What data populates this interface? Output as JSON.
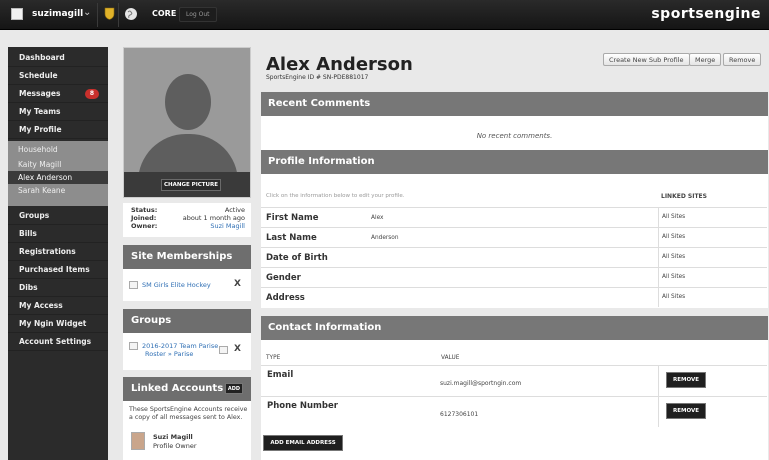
{
  "topbar": {
    "username": "suzimagill",
    "core_label": "CORE",
    "logout_label": "Log Out",
    "brand": "sportsengine"
  },
  "nav": {
    "items": [
      {
        "label": "Dashboard"
      },
      {
        "label": "Schedule"
      },
      {
        "label": "Messages",
        "badge": "8"
      },
      {
        "label": "My Teams"
      },
      {
        "label": "My Profile"
      }
    ],
    "household": {
      "title": "Household",
      "members": [
        "Kaity Magill",
        "Alex Anderson",
        "Sarah Keane"
      ],
      "active_member": "Alex Anderson"
    },
    "items2": [
      {
        "label": "Groups"
      },
      {
        "label": "Bills"
      },
      {
        "label": "Registrations"
      },
      {
        "label": "Purchased Items"
      },
      {
        "label": "Dibs"
      },
      {
        "label": "My Access"
      },
      {
        "label": "My Ngin Widget"
      },
      {
        "label": "Account Settings"
      }
    ]
  },
  "profile": {
    "change_picture_label": "CHANGE PICTURE",
    "status_label": "Status:",
    "status_value": "Active",
    "joined_label": "Joined:",
    "joined_value": "about 1 month ago",
    "owner_label": "Owner:",
    "owner_value": "Suzi Magill"
  },
  "site_memberships": {
    "title": "Site Memberships",
    "items": [
      {
        "name": "SM Girls Elite Hockey",
        "remove": "X"
      }
    ]
  },
  "groups": {
    "title": "Groups",
    "items": [
      {
        "line1": "2016-2017 Team Parise",
        "line2": "Roster » Parise",
        "remove": "X"
      }
    ]
  },
  "linked_accounts": {
    "title": "Linked Accounts",
    "add_label": "ADD",
    "description": "These SportsEngine Accounts receive a copy of all messages sent to Alex.",
    "accounts": [
      {
        "name": "Suzi Magill",
        "role": "Profile Owner"
      }
    ]
  },
  "header": {
    "name": "Alex Anderson",
    "se_id": "SportsEngine ID #  SN-PDE881017",
    "buttons": {
      "create_sub": "Create New Sub Profile",
      "merge": "Merge",
      "remove": "Remove"
    }
  },
  "recent_comments": {
    "title": "Recent Comments",
    "empty_text": "No recent comments."
  },
  "profile_info": {
    "title": "Profile Information",
    "hint": "Click on the information below to edit your profile.",
    "linked_sites_header": "LINKED SITES",
    "rows": [
      {
        "label": "First Name",
        "value": "Alex",
        "sites": "All Sites"
      },
      {
        "label": "Last Name",
        "value": "Anderson",
        "sites": "All Sites"
      },
      {
        "label": "Date of Birth",
        "value": "",
        "sites": "All Sites"
      },
      {
        "label": "Gender",
        "value": "",
        "sites": "All Sites"
      },
      {
        "label": "Address",
        "value": "",
        "sites": "All Sites"
      }
    ]
  },
  "contact_info": {
    "title": "Contact Information",
    "type_header": "TYPE",
    "value_header": "VALUE",
    "rows": [
      {
        "label": "Email",
        "value": "suzi.magill@sportngin.com",
        "remove": "REMOVE"
      },
      {
        "label": "Phone Number",
        "value": "6127306101",
        "remove": "REMOVE"
      }
    ],
    "add_email_label": "ADD EMAIL ADDRESS"
  },
  "colors": {
    "topbar": "#1c1c1c",
    "nav": "#2b2b2b",
    "section_header": "#777777",
    "link": "#2f6fb4",
    "badge": "#c9302c"
  }
}
